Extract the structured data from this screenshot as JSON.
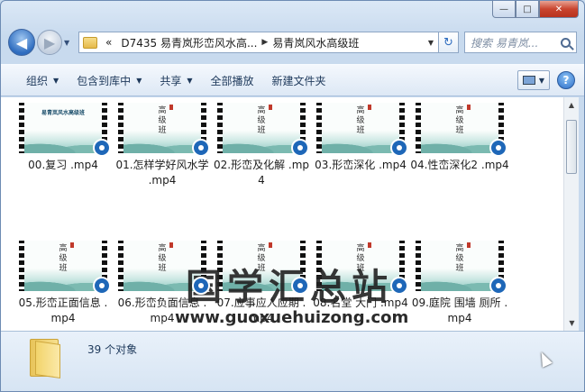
{
  "window": {
    "minimize": "—",
    "maximize": "□",
    "close": "✕"
  },
  "nav": {
    "back": "◀",
    "forward": "▶",
    "history": "▼",
    "address": {
      "overflow": "«",
      "segments": [
        "D7435 易青岚形峦风水高...",
        "易青岚风水高级班"
      ],
      "separator": "▶",
      "dropdown": "▼"
    },
    "refresh": "↻",
    "search_placeholder": "搜索 易青岚..."
  },
  "toolbar": {
    "organize": "组织",
    "include_in_library": "包含到库中",
    "share": "共享",
    "play_all": "全部播放",
    "new_folder": "新建文件夹",
    "caret": "▼",
    "help": "?"
  },
  "files": [
    {
      "name": "00.复习 .mp4",
      "thumb": "title",
      "caption": "易青岚风水高级班"
    },
    {
      "name": "01.怎样学好风水学 .mp4",
      "thumb": "class",
      "caption": "高级班"
    },
    {
      "name": "02.形峦及化解 .mp4",
      "thumb": "class",
      "caption": "高级班"
    },
    {
      "name": "03.形峦深化 .mp4",
      "thumb": "class",
      "caption": "高级班"
    },
    {
      "name": "04.性峦深化2 .mp4",
      "thumb": "class",
      "caption": "高级班"
    },
    {
      "name": "05.形峦正面信息 .mp4",
      "thumb": "class",
      "caption": "高级班"
    },
    {
      "name": "06.形峦负面信息 .mp4",
      "thumb": "class",
      "caption": "高级班"
    },
    {
      "name": "07.应事应人应期 .mp4",
      "thumb": "class",
      "caption": "高级班"
    },
    {
      "name": "08.名堂 大门 .mp4",
      "thumb": "class",
      "caption": "高级班"
    },
    {
      "name": "09.庭院 围墙 厕所 .mp4",
      "thumb": "class",
      "caption": "高级班"
    }
  ],
  "watermark": {
    "title": "国学汇总站",
    "url": "www.guoxuehuizong.com"
  },
  "details": {
    "count": "39 个对象"
  },
  "scrollbar": {
    "up": "▲",
    "down": "▼"
  }
}
